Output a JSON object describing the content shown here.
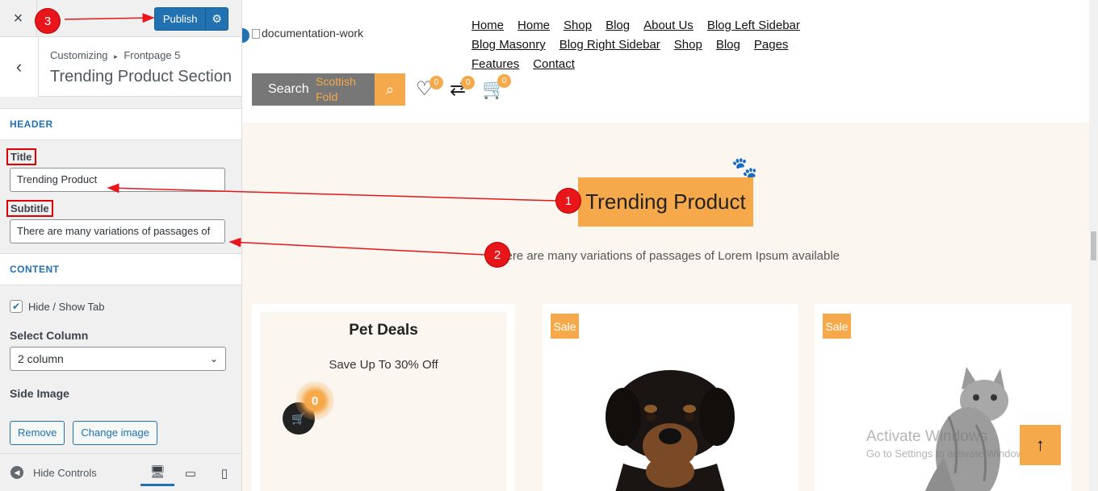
{
  "customizer": {
    "close_icon": "×",
    "publish_label": "Publish",
    "breadcrumb_root": "Customizing",
    "breadcrumb_sep": "▸",
    "breadcrumb_page": "Frontpage 5",
    "section_title": "Trending Product Section",
    "header_group": "HEADER",
    "title_label": "Title",
    "title_value": "Trending Product",
    "subtitle_label": "Subtitle",
    "subtitle_value": "There are many variations of passages of",
    "content_group": "CONTENT",
    "hide_show_tab_label": "Hide / Show Tab",
    "hide_show_tab_checked": true,
    "select_column_label": "Select Column",
    "select_column_value": "2 column",
    "side_image_label": "Side Image",
    "remove_label": "Remove",
    "change_image_label": "Change image",
    "hide_controls_label": "Hide Controls"
  },
  "site": {
    "logo_alt": "documentation-work",
    "nav": [
      "Home",
      "Home",
      "Shop",
      "Blog",
      "About Us",
      "Blog Left Sidebar",
      "Blog Masonry",
      "Blog Right Sidebar",
      "Shop",
      "Blog",
      "Pages",
      "Features",
      "Contact"
    ],
    "search_label": "Search",
    "search_category": "Scottish Fold",
    "wishlist_count": "0",
    "compare_count": "0",
    "cart_count": "0",
    "section_title": "Trending Product",
    "section_subtitle": "There are many variations of passages of Lorem Ipsum available",
    "deals_title": "Pet Deals",
    "deals_subtitle": "Save Up To 30% Off",
    "deals_count": "0",
    "sale_label_1": "Sale",
    "sale_label_2": "Sale",
    "activate_line1": "Activate Windows",
    "activate_line2": "Go to Settings to activate Windows."
  },
  "annotations": {
    "step1": "1",
    "step2": "2",
    "step3": "3"
  },
  "colors": {
    "accent": "#f5a94a",
    "wp_blue": "#2271b1",
    "annotation_red": "#e8151a"
  }
}
